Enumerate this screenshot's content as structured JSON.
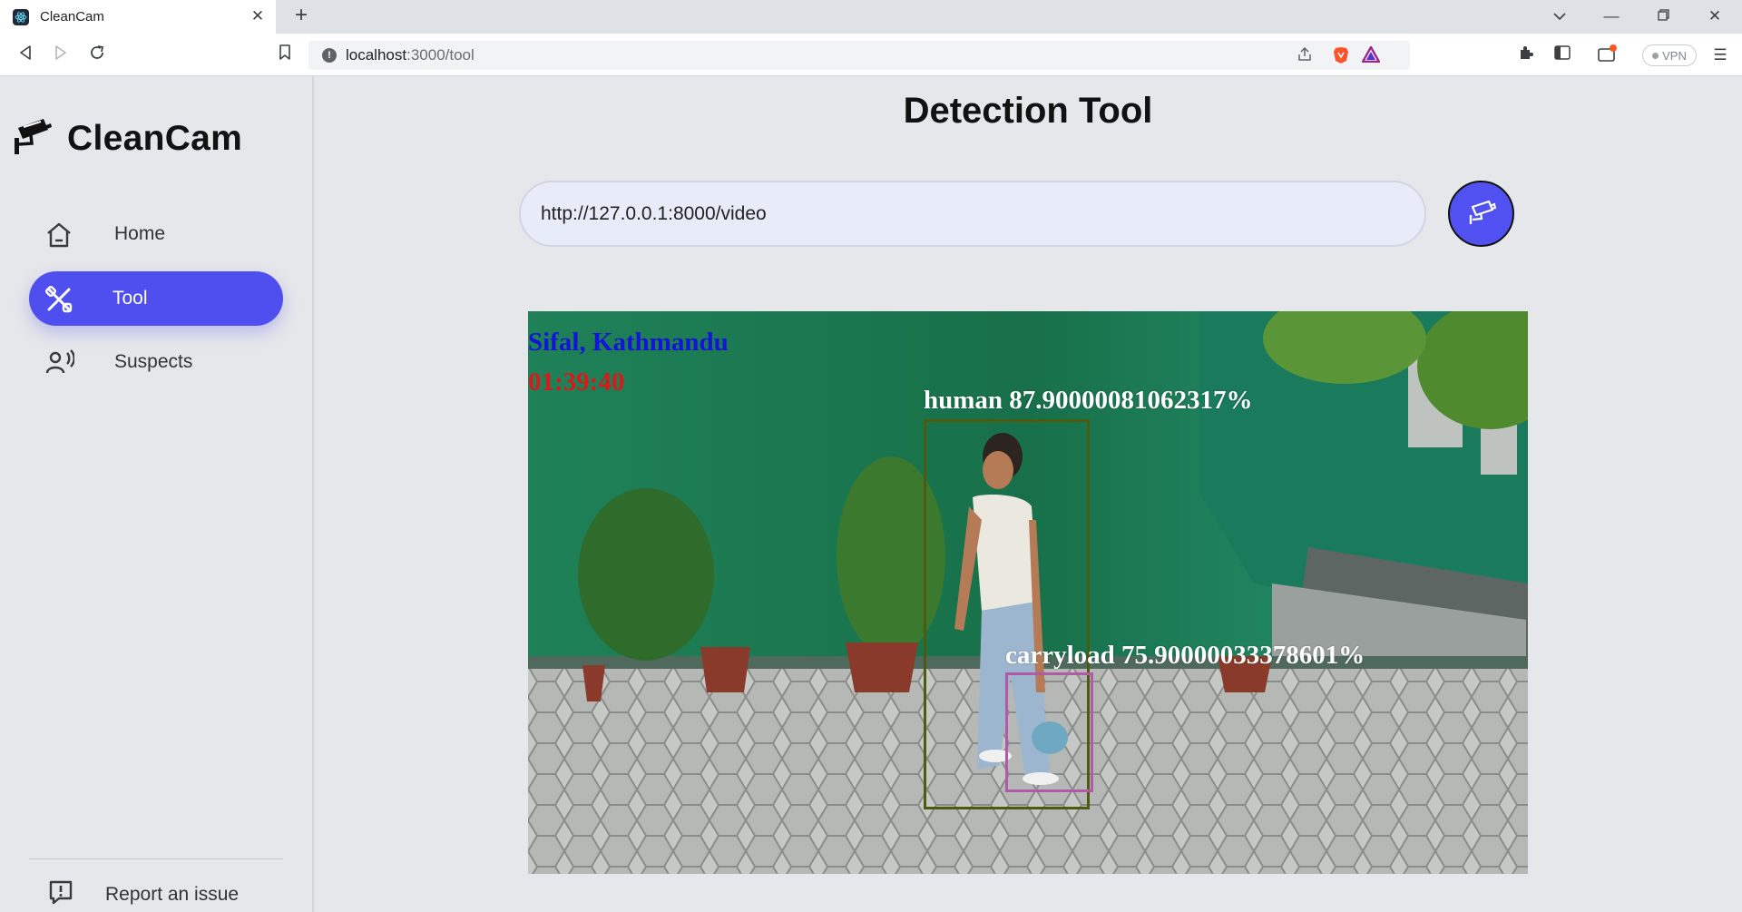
{
  "browser": {
    "tab_title": "CleanCam",
    "url_host": "localhost",
    "url_path": ":3000/tool",
    "vpn_label": "VPN"
  },
  "sidebar": {
    "brand": "CleanCam",
    "items": [
      {
        "label": "Home",
        "icon": "home-icon",
        "active": false
      },
      {
        "label": "Tool",
        "icon": "tool-icon",
        "active": true
      },
      {
        "label": "Suspects",
        "icon": "suspects-icon",
        "active": false
      }
    ],
    "report_label": "Report an issue"
  },
  "main": {
    "title": "Detection Tool",
    "stream_url": "http://127.0.0.1:8000/video",
    "video": {
      "location": "Sifal, Kathmandu",
      "timestamp": "01:39:40",
      "detections": [
        {
          "label": "human  87.90000081062317%",
          "color": "#4d5a10"
        },
        {
          "label": "carryload  75.90000033378601%",
          "color": "#b05aa8"
        }
      ]
    }
  },
  "colors": {
    "accent": "#4f4ff0",
    "location_text": "#1414d8",
    "timestamp_text": "#d81a1a"
  }
}
